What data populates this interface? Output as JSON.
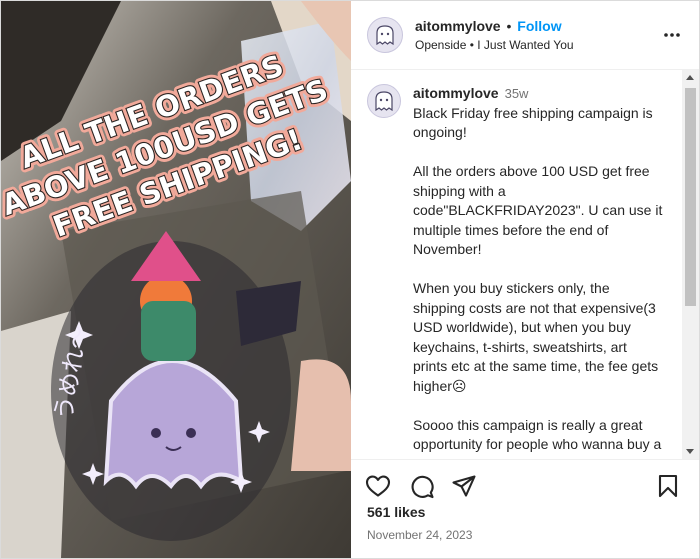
{
  "media": {
    "overlay_lines": [
      "ALL THE ORDERS",
      "ABOVE 100USD GETS",
      "FREE SHIPPING!"
    ],
    "sticker_text": "うめれ〜"
  },
  "header": {
    "username": "aitommylove",
    "separator": "•",
    "follow_label": "Follow",
    "subtitle_artist": "Openside",
    "subtitle_separator": "•",
    "subtitle_track": "I Just Wanted You"
  },
  "caption": {
    "username": "aitommylove",
    "age": "35w",
    "paragraphs": [
      "Black Friday free shipping campaign is ongoing!",
      "All the orders above 100 USD get free shipping with a code\"BLACKFRIDAY2023\". U can use it multiple times before the end of November!",
      "When you buy stickers only, the shipping costs are not that expensive(3 USD worldwide), but when you buy keychains, t-shirts, sweatshirts, art prints etc at the same time, the fee gets higher☹",
      "Soooo this campaign is really a great opportunity for people who wanna buy a lot of items from me!"
    ]
  },
  "actions": {
    "icons": [
      "heart-icon",
      "comment-icon",
      "share-icon",
      "bookmark-icon"
    ]
  },
  "likes": "561 likes",
  "date": "November 24, 2023",
  "colors": {
    "follow": "#0095f6",
    "overlay_text": "#ffffff",
    "overlay_outline": "#f1a99a"
  }
}
